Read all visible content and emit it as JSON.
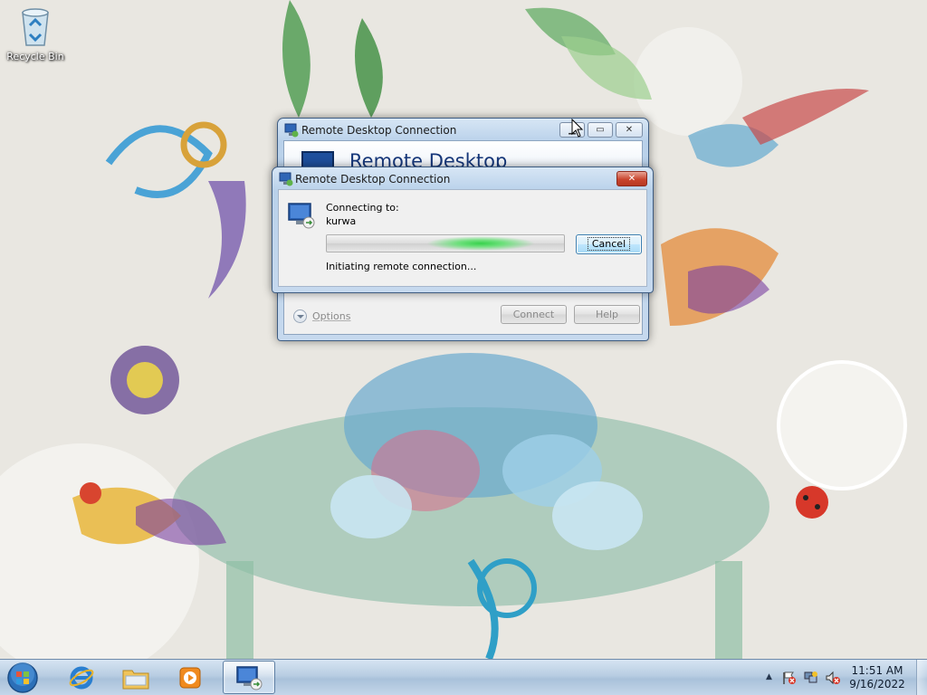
{
  "desktop": {
    "icons": [
      {
        "label": "Recycle Bin",
        "icon": "recycle-bin-icon"
      }
    ]
  },
  "main_window": {
    "title": "Remote Desktop Connection",
    "banner_title": "Remote Desktop",
    "options_label": "Options",
    "connect_label": "Connect",
    "help_label": "Help",
    "caption_buttons": [
      "minimize",
      "maximize",
      "close"
    ]
  },
  "progress_dialog": {
    "title": "Remote Desktop Connection",
    "connecting_label": "Connecting to:",
    "host": "kurwa",
    "status": "Initiating remote connection...",
    "cancel_label": "Cancel",
    "progress_style": "marquee"
  },
  "taskbar": {
    "pinned": [
      {
        "name": "start-orb",
        "icon": "windows-orb-icon"
      },
      {
        "name": "internet-explorer",
        "icon": "internet-explorer-icon"
      },
      {
        "name": "windows-explorer",
        "icon": "folder-icon"
      },
      {
        "name": "media-player",
        "icon": "media-player-icon"
      },
      {
        "name": "remote-desktop",
        "icon": "remote-desktop-icon",
        "active": true
      }
    ],
    "tray": {
      "icons": [
        "action-center-flag-icon",
        "network-icon",
        "volume-muted-icon"
      ]
    },
    "clock": {
      "time": "11:51 AM",
      "date": "9/16/2022"
    }
  },
  "colors": {
    "title_blue": "#16377a",
    "close_red": "#c9452f",
    "progress_green": "#37d24c",
    "taskbar_blue": "#b8cde2"
  }
}
